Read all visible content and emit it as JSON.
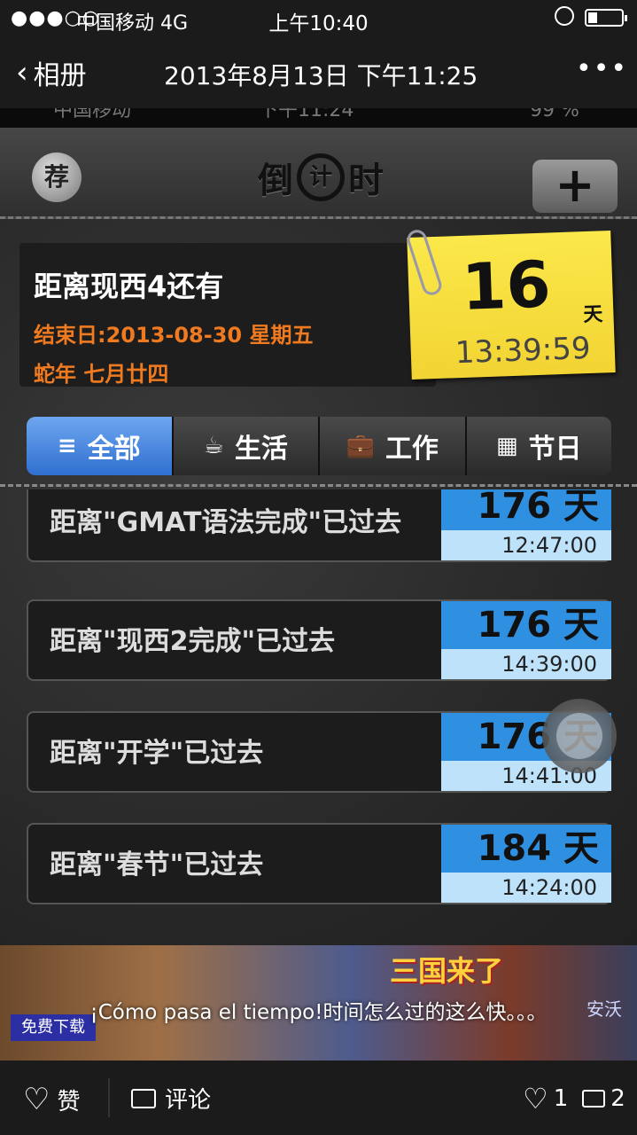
{
  "status_bar": {
    "signal": "●●●○○",
    "carrier": "中国移动  4G",
    "time": "上午10:40"
  },
  "nav": {
    "back_label": "相册",
    "title": "2013年8月13日 下午11:25",
    "more": "•••"
  },
  "photo": {
    "inner_status": {
      "left": "中国移动",
      "time": "下午11:24",
      "battery": "99 %"
    },
    "header": {
      "recommend_label": "荐",
      "title_left": "倒",
      "title_mid": "计",
      "title_right": "时",
      "add_label": "+"
    },
    "featured": {
      "name": "距离现西4还有",
      "end_date": "结束日:2013-08-30 星期五",
      "lunar": "蛇年 七月廿四",
      "days": "16",
      "unit": "天",
      "time": "13:39:59"
    },
    "tabs": [
      {
        "icon": "≡",
        "label": "全部"
      },
      {
        "icon": "☕",
        "label": "生活"
      },
      {
        "icon": "💼",
        "label": "工作"
      },
      {
        "icon": "▦",
        "label": "节日"
      }
    ],
    "rows": [
      {
        "label": "距离\"GMAT语法完成\"已过去",
        "days": "176 天",
        "time": "12:47:00"
      },
      {
        "label": "距离\"现西2完成\"已过去",
        "days": "176 天",
        "time": "14:39:00"
      },
      {
        "label": "距离\"开学\"已过去",
        "days": "176 天",
        "time": "14:41:00"
      },
      {
        "label": "距离\"春节\"已过去",
        "days": "184 天",
        "time": "14:24:00"
      }
    ],
    "banner": {
      "title": "三国来了",
      "free": "免费下载",
      "install": "安沃"
    }
  },
  "caption": "¡Cómo pasa  el tiempo!时间怎么过的这么快。。。",
  "actions": {
    "like_label": "赞",
    "comment_label": "评论",
    "like_count": "1",
    "comment_count": "2"
  }
}
